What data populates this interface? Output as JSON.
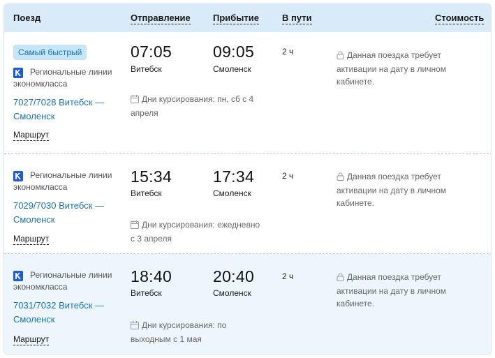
{
  "header": {
    "train": "Поезд",
    "departure": "Отправление",
    "arrival": "Прибытие",
    "duration": "В пути",
    "price": "Стоимость"
  },
  "icons": {
    "operator": "operator-logo-icon",
    "calendar": "calendar-icon",
    "lock": "lock-icon"
  },
  "colors": {
    "header_bg": "#d9eaf8",
    "link": "#1672b8",
    "badge_bg": "#c6e5f7",
    "operator_logo": "#1e5bd6"
  },
  "rows": [
    {
      "badge": "Самый быстрый",
      "operator_line1": "Региональные линии",
      "operator_line2": "экономкласса",
      "train_line1": "7027/7028 Витебск —",
      "train_line2": "Смоленск",
      "route_label": "Маршрут",
      "dep_time": "07:05",
      "dep_city": "Витебск",
      "arr_time": "09:05",
      "arr_city": "Смоленск",
      "duration": "2 ч",
      "days_line1": "Дни курсирования: пн, сб с 4",
      "days_line2": "апреля",
      "note_line1": "Данная поездка требует",
      "note_line2": "активации на дату в личном",
      "note_line3": "кабинете."
    },
    {
      "operator_line1": "Региональные линии",
      "operator_line2": "экономкласса",
      "train_line1": "7029/7030 Витебск —",
      "train_line2": "Смоленск",
      "route_label": "Маршрут",
      "dep_time": "15:34",
      "dep_city": "Витебск",
      "arr_time": "17:34",
      "arr_city": "Смоленск",
      "duration": "2 ч",
      "days_line1": "Дни курсирования: ежедневно",
      "days_line2": "с 3 апреля",
      "note_line1": "Данная поездка требует",
      "note_line2": "активации на дату в личном",
      "note_line3": "кабинете."
    },
    {
      "operator_line1": "Региональные линии",
      "operator_line2": "экономкласса",
      "train_line1": "7031/7032 Витебск —",
      "train_line2": "Смоленск",
      "route_label": "Маршрут",
      "dep_time": "18:40",
      "dep_city": "Витебск",
      "arr_time": "20:40",
      "arr_city": "Смоленск",
      "duration": "2 ч",
      "days_line1": "Дни курсирования: по",
      "days_line2": "выходным с 1 мая",
      "note_line1": "Данная поездка требует",
      "note_line2": "активации на дату в личном",
      "note_line3": "кабинете."
    }
  ]
}
